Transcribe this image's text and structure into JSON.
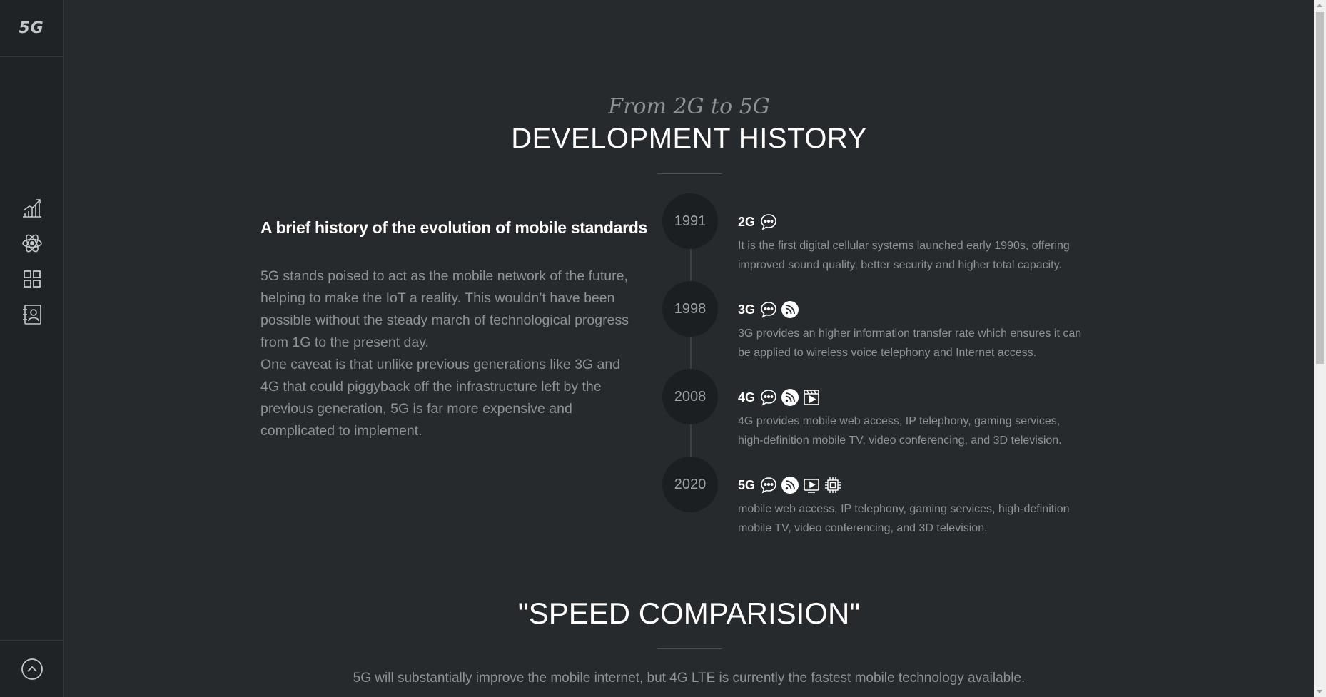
{
  "sidebar": {
    "logo": "5G",
    "nav": [
      {
        "icon": "chart-growth-icon"
      },
      {
        "icon": "atom-icon"
      },
      {
        "icon": "grid-icon"
      },
      {
        "icon": "contact-card-icon"
      }
    ],
    "bottom_icon": "scroll-up-icon"
  },
  "history": {
    "subtitle": "From 2G to 5G",
    "title": "DEVELOPMENT HISTORY",
    "brief_heading": "A brief history of the evolution of mobile standards",
    "brief_paragraph_1": "5G stands poised to act as the mobile network of the future, helping to make the IoT a reality. This wouldn’t have been possible without the steady march of technological progress from 1G to the present day.",
    "brief_paragraph_2": "One caveat is that unlike previous generations like 3G and 4G that could piggyback off the infrastructure left by the previous generation, 5G is far more expensive and complicated to implement."
  },
  "timeline": [
    {
      "year": "1991",
      "generation": "2G",
      "icons": [
        "chat-icon"
      ],
      "description": "It is the first digital cellular systems launched early 1990s, offering improved sound quality, better security and higher total capacity."
    },
    {
      "year": "1998",
      "generation": "3G",
      "icons": [
        "chat-icon",
        "rss-icon"
      ],
      "description": "3G provides an higher information transfer rate which ensures it can be applied to wireless voice telephony and Internet access."
    },
    {
      "year": "2008",
      "generation": "4G",
      "icons": [
        "chat-icon",
        "rss-icon",
        "video-icon"
      ],
      "description": "4G provides mobile web access, IP telephony, gaming services, high-definition mobile TV, video conferencing, and 3D television."
    },
    {
      "year": "2020",
      "generation": "5G",
      "icons": [
        "chat-icon",
        "rss-icon",
        "screen-play-icon",
        "chip-icon"
      ],
      "description": "mobile web access, IP telephony, gaming services, high-definition mobile TV, video conferencing, and 3D television."
    }
  ],
  "speed": {
    "title": "\"SPEED COMPARISION\"",
    "description": "5G will substantially improve the mobile internet, but 4G LTE is currently the fastest mobile technology available."
  },
  "colors": {
    "background": "#262a2d",
    "sidebar": "#1f2326",
    "year_circle": "#1b1f21",
    "text_muted": "#8d9295",
    "text_bright": "#ffffff"
  }
}
